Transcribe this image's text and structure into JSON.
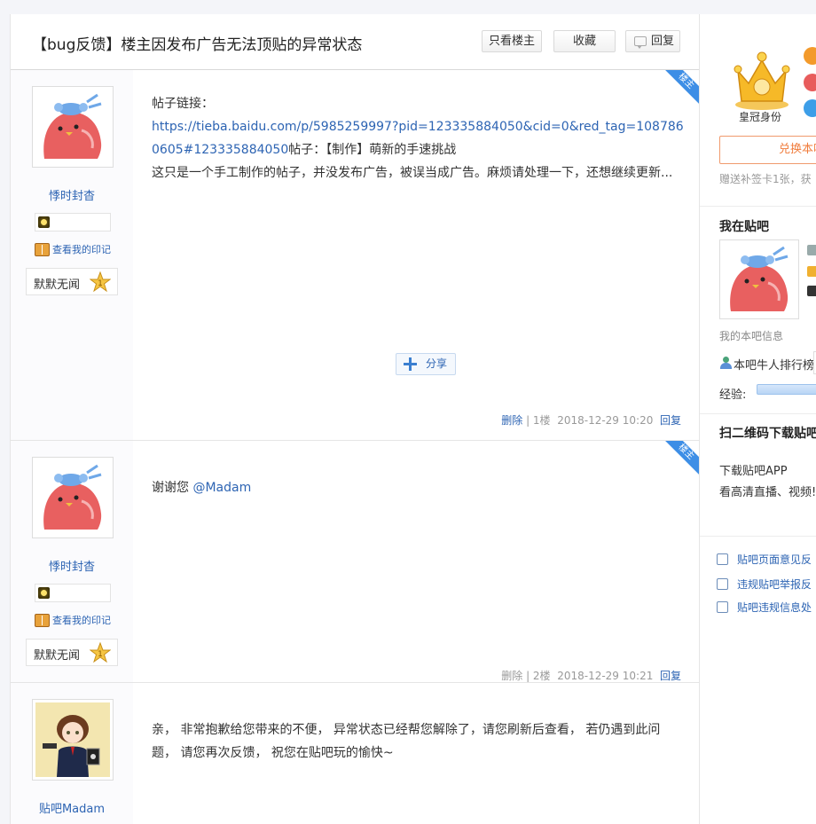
{
  "thread": {
    "title": "【bug反馈】楼主因发布广告无法顶贴的异常状态",
    "only_op_label": "只看楼主",
    "favorite_label": "收藏",
    "reply_label": "回复"
  },
  "posts": [
    {
      "op_tag": "楼主",
      "username": "悸时封杳",
      "mark_link": "查看我的印记",
      "level_text": "默默无闻",
      "level_num": "1",
      "content_line1": "帖子链接：",
      "content_link": "https://tieba.baidu.com/p/5985259997?pid=123335884050&cid=0&red_tag=1087860605#123335884050",
      "content_after_link": "帖子：【制作】萌新的手速挑战",
      "content_line3": "这只是一个手工制作的帖子，并没发布广告，被误当成广告。麻烦请处理一下，还想继续更新...",
      "share_label": "分享",
      "delete_label": "删除",
      "floor": "1楼",
      "time": "2018-12-29 10:20",
      "reply_label": "回复"
    },
    {
      "op_tag": "楼主",
      "username": "悸时封杳",
      "mark_link": "查看我的印记",
      "level_text": "默默无闻",
      "level_num": "1",
      "content_text": "谢谢您 ",
      "content_mention": "@Madam",
      "delete_label": "删除",
      "floor": "2楼",
      "time": "2018-12-29 10:21",
      "reply_label": "回复"
    },
    {
      "username": "贴吧Madam",
      "content_text": "亲， 非常抱歉给您带来的不便， 异常状态已经帮您解除了，请您刷新后查看， 若仍遇到此问题， 请您再次反馈， 祝您在贴吧玩的愉快~"
    }
  ],
  "sidebar": {
    "crown_caption": "皇冠身份",
    "exchange_label": "兑换本吧",
    "gift_text": "赠送补签卡1张，获",
    "my_tieba_title": "我在贴吧",
    "my_info": "我的本吧信息",
    "rank_label": "本吧牛人排行榜",
    "xp_label": "经验:",
    "qr_title": "扫二维码下载贴吧",
    "download_app": "下载贴吧APP",
    "download_desc": "看高清直播、视频!",
    "link_feedback": "贴吧页面意见反",
    "link_report": "违规贴吧举报反",
    "link_violation": "贴吧违规信息处"
  },
  "colors": {
    "link_blue": "#2d64b3",
    "op_tag_blue": "#3d8ee6",
    "exchange_orange": "#f07c3c"
  }
}
